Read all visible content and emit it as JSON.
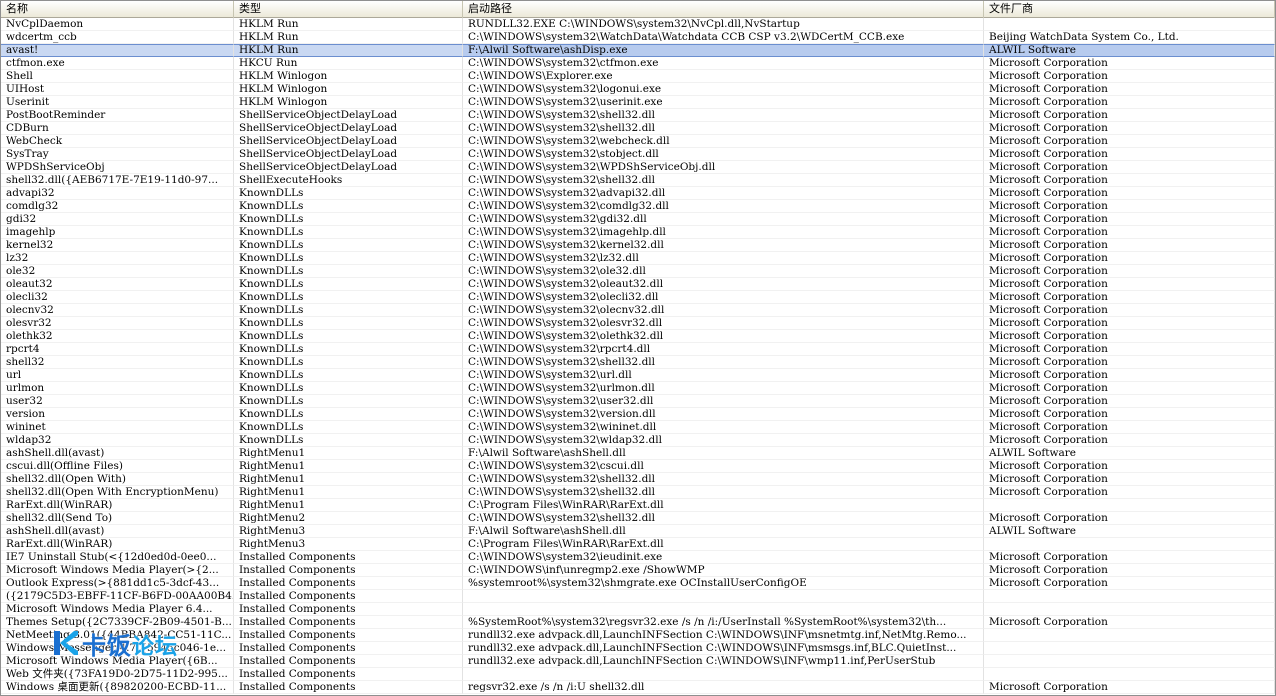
{
  "columns": [
    "名称",
    "类型",
    "启动路径",
    "文件厂商"
  ],
  "selected_index": 2,
  "rows": [
    [
      "NvCplDaemon",
      "HKLM Run",
      "RUNDLL32.EXE C:\\WINDOWS\\system32\\NvCpl.dll,NvStartup",
      ""
    ],
    [
      "wdcertm_ccb",
      "HKLM Run",
      "C:\\WINDOWS\\system32\\WatchData\\Watchdata CCB CSP v3.2\\WDCertM_CCB.exe",
      "Beijing WatchData System Co., Ltd."
    ],
    [
      "avast!",
      "HKLM Run",
      "F:\\Alwil Software\\ashDisp.exe",
      "ALWIL Software"
    ],
    [
      "ctfmon.exe",
      "HKCU Run",
      "C:\\WINDOWS\\system32\\ctfmon.exe",
      "Microsoft Corporation"
    ],
    [
      "Shell",
      "HKLM Winlogon",
      "C:\\WINDOWS\\Explorer.exe",
      "Microsoft Corporation"
    ],
    [
      "UIHost",
      "HKLM Winlogon",
      "C:\\WINDOWS\\system32\\logonui.exe",
      "Microsoft Corporation"
    ],
    [
      "Userinit",
      "HKLM Winlogon",
      "C:\\WINDOWS\\system32\\userinit.exe",
      "Microsoft Corporation"
    ],
    [
      "PostBootReminder",
      "ShellServiceObjectDelayLoad",
      "C:\\WINDOWS\\system32\\shell32.dll",
      "Microsoft Corporation"
    ],
    [
      "CDBurn",
      "ShellServiceObjectDelayLoad",
      "C:\\WINDOWS\\system32\\shell32.dll",
      "Microsoft Corporation"
    ],
    [
      "WebCheck",
      "ShellServiceObjectDelayLoad",
      "C:\\WINDOWS\\system32\\webcheck.dll",
      "Microsoft Corporation"
    ],
    [
      "SysTray",
      "ShellServiceObjectDelayLoad",
      "C:\\WINDOWS\\system32\\stobject.dll",
      "Microsoft Corporation"
    ],
    [
      "WPDShServiceObj",
      "ShellServiceObjectDelayLoad",
      "C:\\WINDOWS\\system32\\WPDShServiceObj.dll",
      "Microsoft Corporation"
    ],
    [
      "shell32.dll({AEB6717E-7E19-11d0-97...",
      "ShellExecuteHooks",
      "C:\\WINDOWS\\system32\\shell32.dll",
      "Microsoft Corporation"
    ],
    [
      "advapi32",
      "KnownDLLs",
      "C:\\WINDOWS\\system32\\advapi32.dll",
      "Microsoft Corporation"
    ],
    [
      "comdlg32",
      "KnownDLLs",
      "C:\\WINDOWS\\system32\\comdlg32.dll",
      "Microsoft Corporation"
    ],
    [
      "gdi32",
      "KnownDLLs",
      "C:\\WINDOWS\\system32\\gdi32.dll",
      "Microsoft Corporation"
    ],
    [
      "imagehlp",
      "KnownDLLs",
      "C:\\WINDOWS\\system32\\imagehlp.dll",
      "Microsoft Corporation"
    ],
    [
      "kernel32",
      "KnownDLLs",
      "C:\\WINDOWS\\system32\\kernel32.dll",
      "Microsoft Corporation"
    ],
    [
      "lz32",
      "KnownDLLs",
      "C:\\WINDOWS\\system32\\lz32.dll",
      "Microsoft Corporation"
    ],
    [
      "ole32",
      "KnownDLLs",
      "C:\\WINDOWS\\system32\\ole32.dll",
      "Microsoft Corporation"
    ],
    [
      "oleaut32",
      "KnownDLLs",
      "C:\\WINDOWS\\system32\\oleaut32.dll",
      "Microsoft Corporation"
    ],
    [
      "olecli32",
      "KnownDLLs",
      "C:\\WINDOWS\\system32\\olecli32.dll",
      "Microsoft Corporation"
    ],
    [
      "olecnv32",
      "KnownDLLs",
      "C:\\WINDOWS\\system32\\olecnv32.dll",
      "Microsoft Corporation"
    ],
    [
      "olesvr32",
      "KnownDLLs",
      "C:\\WINDOWS\\system32\\olesvr32.dll",
      "Microsoft Corporation"
    ],
    [
      "olethk32",
      "KnownDLLs",
      "C:\\WINDOWS\\system32\\olethk32.dll",
      "Microsoft Corporation"
    ],
    [
      "rpcrt4",
      "KnownDLLs",
      "C:\\WINDOWS\\system32\\rpcrt4.dll",
      "Microsoft Corporation"
    ],
    [
      "shell32",
      "KnownDLLs",
      "C:\\WINDOWS\\system32\\shell32.dll",
      "Microsoft Corporation"
    ],
    [
      "url",
      "KnownDLLs",
      "C:\\WINDOWS\\system32\\url.dll",
      "Microsoft Corporation"
    ],
    [
      "urlmon",
      "KnownDLLs",
      "C:\\WINDOWS\\system32\\urlmon.dll",
      "Microsoft Corporation"
    ],
    [
      "user32",
      "KnownDLLs",
      "C:\\WINDOWS\\system32\\user32.dll",
      "Microsoft Corporation"
    ],
    [
      "version",
      "KnownDLLs",
      "C:\\WINDOWS\\system32\\version.dll",
      "Microsoft Corporation"
    ],
    [
      "wininet",
      "KnownDLLs",
      "C:\\WINDOWS\\system32\\wininet.dll",
      "Microsoft Corporation"
    ],
    [
      "wldap32",
      "KnownDLLs",
      "C:\\WINDOWS\\system32\\wldap32.dll",
      "Microsoft Corporation"
    ],
    [
      "ashShell.dll(avast)",
      "RightMenu1",
      "F:\\Alwil Software\\ashShell.dll",
      "ALWIL Software"
    ],
    [
      "cscui.dll(Offline Files)",
      "RightMenu1",
      "C:\\WINDOWS\\system32\\cscui.dll",
      "Microsoft Corporation"
    ],
    [
      "shell32.dll(Open With)",
      "RightMenu1",
      "C:\\WINDOWS\\system32\\shell32.dll",
      "Microsoft Corporation"
    ],
    [
      "shell32.dll(Open With EncryptionMenu)",
      "RightMenu1",
      "C:\\WINDOWS\\system32\\shell32.dll",
      "Microsoft Corporation"
    ],
    [
      "RarExt.dll(WinRAR)",
      "RightMenu1",
      "C:\\Program Files\\WinRAR\\RarExt.dll",
      ""
    ],
    [
      "shell32.dll(Send To)",
      "RightMenu2",
      "C:\\WINDOWS\\system32\\shell32.dll",
      "Microsoft Corporation"
    ],
    [
      "ashShell.dll(avast)",
      "RightMenu3",
      "F:\\Alwil Software\\ashShell.dll",
      "ALWIL Software"
    ],
    [
      "RarExt.dll(WinRAR)",
      "RightMenu3",
      "C:\\Program Files\\WinRAR\\RarExt.dll",
      ""
    ],
    [
      "IE7 Uninstall Stub(<{12d0ed0d-0ee0...",
      "Installed Components",
      "C:\\WINDOWS\\system32\\ieudinit.exe",
      "Microsoft Corporation"
    ],
    [
      "Microsoft Windows Media Player(>{2...",
      "Installed Components",
      "C:\\WINDOWS\\inf\\unregmp2.exe /ShowWMP",
      "Microsoft Corporation"
    ],
    [
      "Outlook Express(>{881dd1c5-3dcf-43...",
      "Installed Components",
      "%systemroot%\\system32\\shmgrate.exe OCInstallUserConfigOE",
      "Microsoft Corporation"
    ],
    [
      "({2179C5D3-EBFF-11CF-B6FD-00AA00B4...",
      "Installed Components",
      "",
      ""
    ],
    [
      "Microsoft Windows Media Player 6.4...",
      "Installed Components",
      "",
      ""
    ],
    [
      "Themes Setup({2C7339CF-2B09-4501-B...",
      "Installed Components",
      "%SystemRoot%\\system32\\regsvr32.exe /s /n /i:/UserInstall %SystemRoot%\\system32\\th...",
      "Microsoft Corporation"
    ],
    [
      "NetMeeting 3.01({44BBA842-CC51-11C...",
      "Installed Components",
      "rundll32.exe advpack.dll,LaunchINFSection C:\\WINDOWS\\INF\\msnetmtg.inf,NetMtg.Remo...",
      ""
    ],
    [
      "Windows Messenger 4.7({5945c046-1e...",
      "Installed Components",
      "rundll32.exe advpack.dll,LaunchINFSection C:\\WINDOWS\\INF\\msmsgs.inf,BLC.QuietInst...",
      ""
    ],
    [
      "Microsoft Windows Media Player({6B...",
      "Installed Components",
      "rundll32.exe advpack.dll,LaunchINFSection C:\\WINDOWS\\INF\\wmp11.inf,PerUserStub",
      ""
    ],
    [
      "Web 文件夹({73FA19D0-2D75-11D2-995...",
      "Installed Components",
      "",
      ""
    ],
    [
      "Windows 桌面更新({89820200-ECBD-11...",
      "Installed Components",
      "regsvr32.exe /s /n /i:U shell32.dll",
      "Microsoft Corporation"
    ]
  ],
  "watermark": {
    "k": "K",
    "text_a": "卡饭",
    "text_b": "论坛"
  }
}
